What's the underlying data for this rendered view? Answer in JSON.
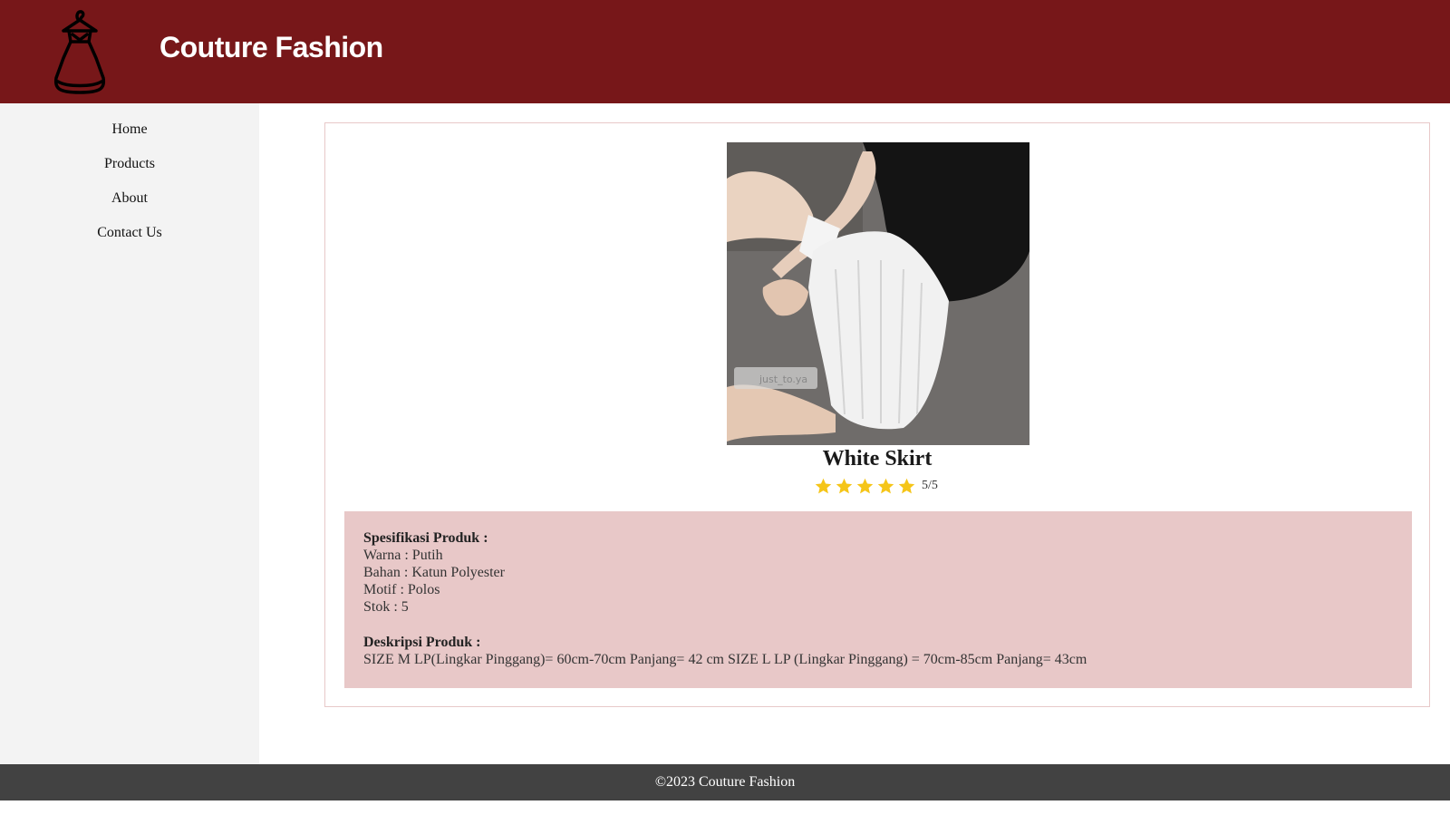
{
  "brand": {
    "name": "Couture Fashion",
    "logo_icon": "dress-on-hanger-icon",
    "header_color": "#771719"
  },
  "nav": {
    "items": [
      {
        "label": "Home"
      },
      {
        "label": "Products"
      },
      {
        "label": "About"
      },
      {
        "label": "Contact Us"
      }
    ]
  },
  "product": {
    "image_icon": "product-photo",
    "image_watermark": "just_to.ya",
    "title": "White Skirt",
    "rating": {
      "stars": 5,
      "max": 5,
      "text": "5/5",
      "star_color": "#f5c518"
    },
    "spec_heading": "Spesifikasi Produk :",
    "specs": [
      "Warna : Putih",
      "Bahan : Katun Polyester",
      "Motif : Polos",
      "Stok : 5"
    ],
    "desc_heading": "Deskripsi Produk :",
    "description": "SIZE M LP(Lingkar Pinggang)= 60cm-70cm Panjang= 42 cm SIZE L LP (Lingkar Pinggang) = 70cm-85cm Panjang= 43cm"
  },
  "footer": {
    "text": "©2023 Couture Fashion",
    "color": "#424242"
  }
}
